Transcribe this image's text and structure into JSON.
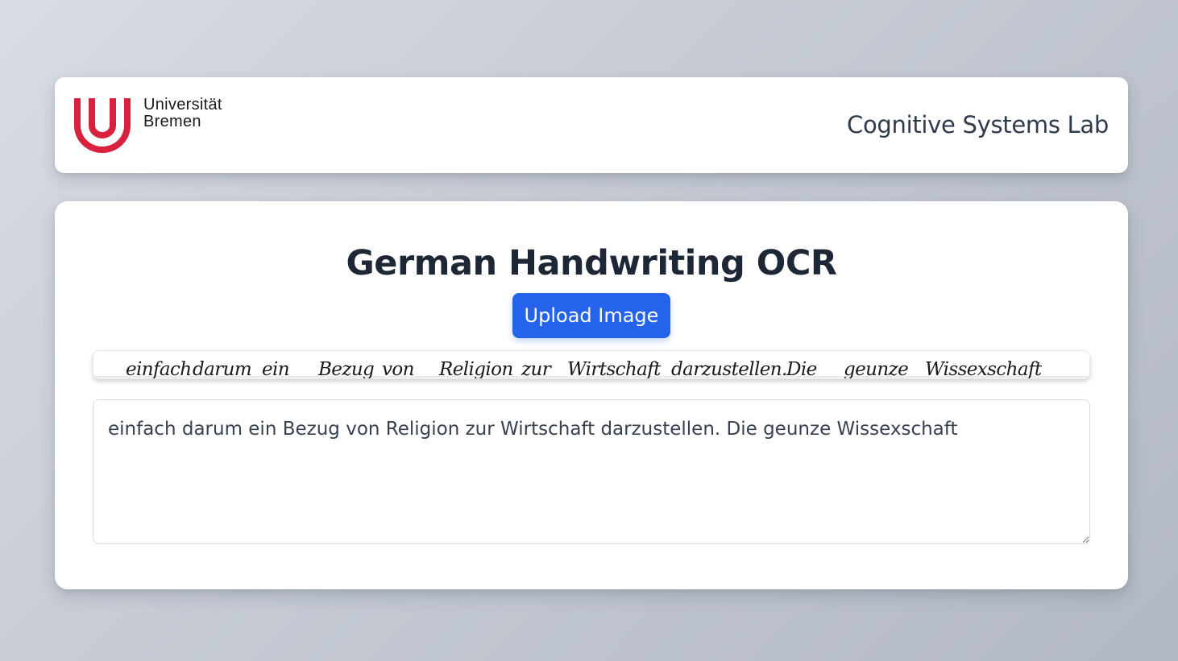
{
  "header": {
    "logo": {
      "line1": "Universität",
      "line2": "Bremen",
      "icon": "uni-bremen-logo",
      "color": "#d8203f"
    },
    "lab_name": "Cognitive Systems Lab"
  },
  "main": {
    "title": "German Handwriting OCR",
    "upload_label": "Upload Image",
    "accent": "#2563eb",
    "handwriting_words": [
      "einfach",
      "darum",
      "ein",
      "Bezug",
      "von",
      "Religion",
      "zur",
      "Wirtschaft",
      "darzustellen.",
      "Die",
      "geunze",
      "Wissexschaft"
    ],
    "output_text": "einfach darum ein Bezug von Religion zur Wirtschaft darzustellen. Die geunze Wissexschaft"
  }
}
